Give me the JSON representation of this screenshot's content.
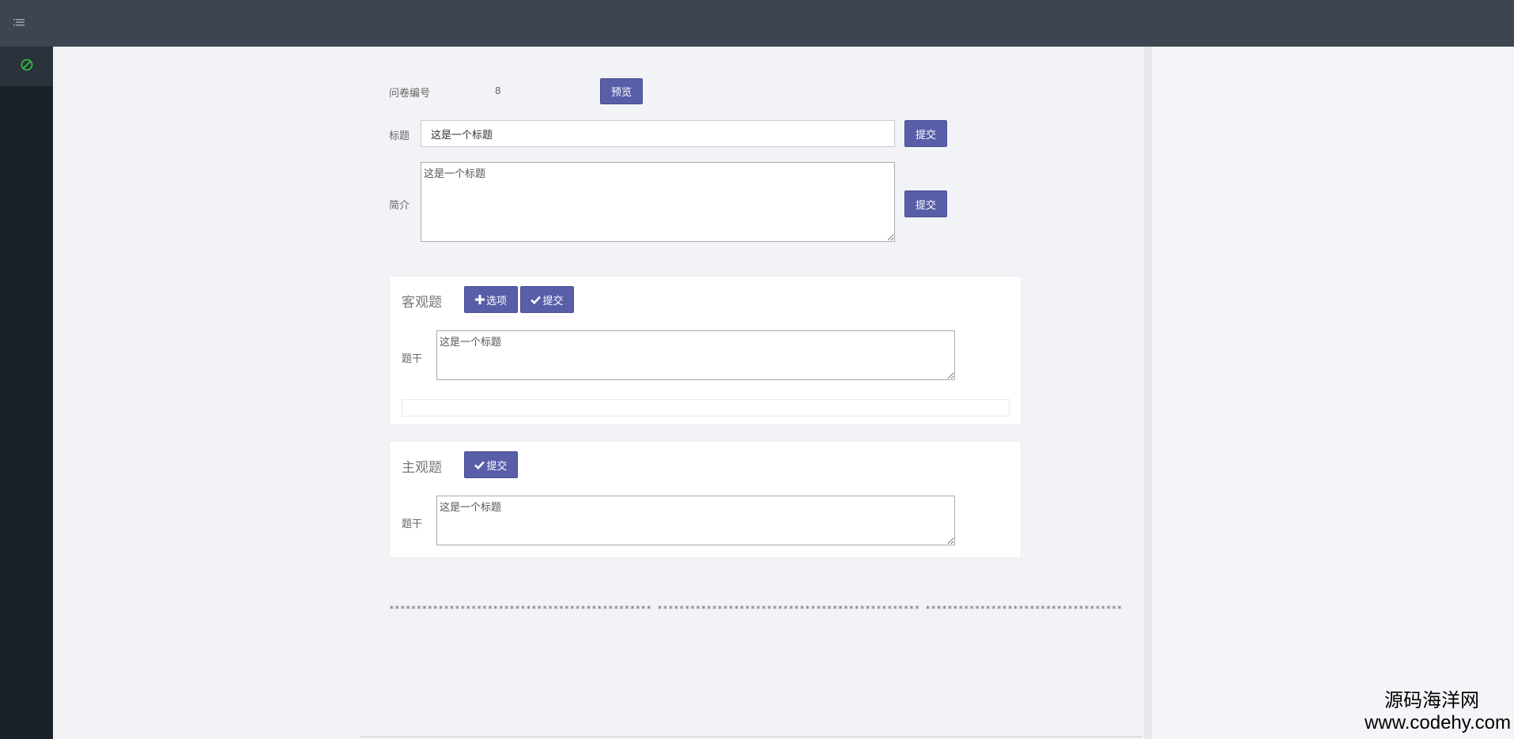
{
  "topbar": {
    "menu_icon": "list-icon"
  },
  "sidebar": {
    "items": [
      {
        "icon": "compass-icon",
        "color": "#2ecc40"
      }
    ]
  },
  "form": {
    "id_label": "问卷编号",
    "id_value": "8",
    "preview_button": "预览",
    "title_label": "标题",
    "title_value": "这是一个标题",
    "title_submit": "提交",
    "intro_label": "简介",
    "intro_value": "这是一个标题",
    "intro_submit": "提交"
  },
  "objective": {
    "title": "客观题",
    "add_option_button": "选项",
    "submit_button": "提交",
    "stem_label": "题干",
    "stem_value": "这是一个标题"
  },
  "subjective": {
    "title": "主观题",
    "submit_button": "提交",
    "stem_label": "题干",
    "stem_value": "这是一个标题"
  },
  "footer_stars": "************************************************ ************************************************ ************************************",
  "watermark": {
    "name": "源码海洋网",
    "url": "www.codehy.com"
  },
  "colors": {
    "button": "#585ea8",
    "topbar": "#3d4650",
    "sidebar": "#1b2128",
    "accent_green": "#2ecc40"
  }
}
